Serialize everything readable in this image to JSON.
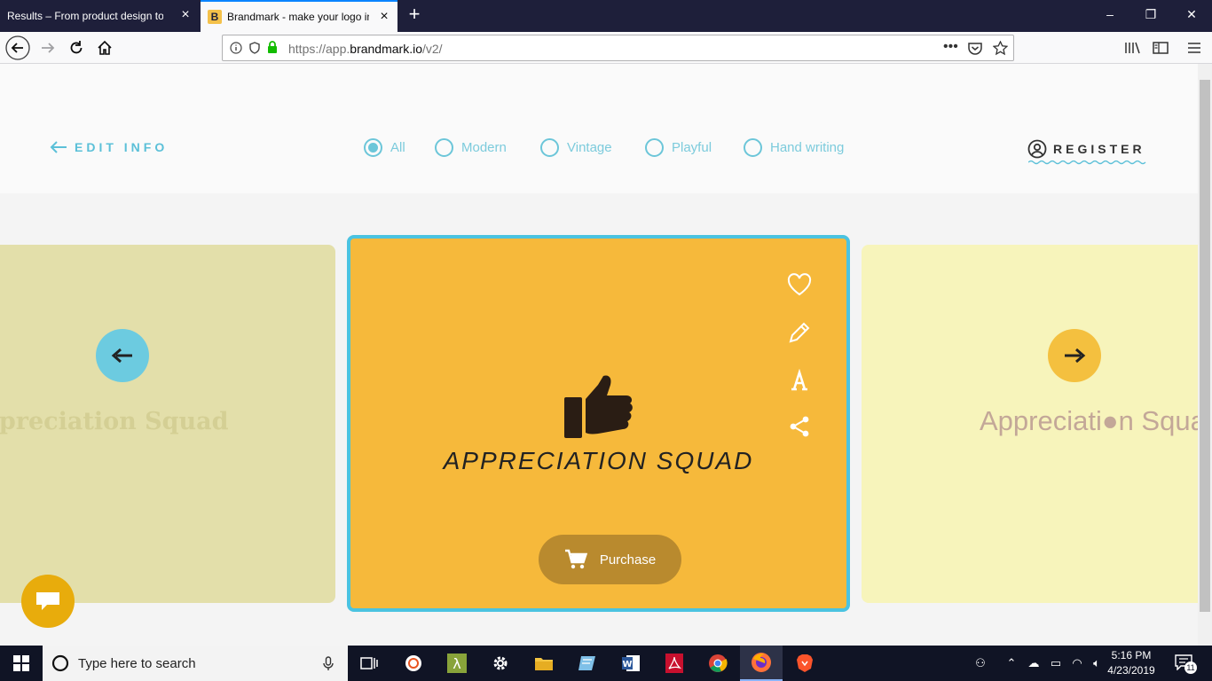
{
  "browser": {
    "tabs": [
      {
        "title": "Results – From product design to d"
      },
      {
        "title": "Brandmark - make your logo in",
        "favicon": "B"
      }
    ],
    "url": {
      "prefix": "https://app.",
      "domain": "brandmark.io",
      "path": "/v2/"
    }
  },
  "header": {
    "edit_info": "EDIT INFO",
    "styles": [
      "All",
      "Modern",
      "Vintage",
      "Playful",
      "Hand writing"
    ],
    "selected_style": "All",
    "register": "REGISTER"
  },
  "cards": {
    "left_name": "ppreciation Squad",
    "center_name": "APPRECIATION SQUAD",
    "right_name": "Appreciati●n Squa",
    "purchase": "Purchase"
  },
  "colors": {
    "accent": "#5bc0d8",
    "center_bg": "#f6b93b",
    "center_border": "#4bc3e0",
    "left_bg": "#e3dfaa",
    "right_bg": "#f7f4bb"
  },
  "taskbar": {
    "search_placeholder": "Type here to search",
    "time": "5:16 PM",
    "date": "4/23/2019",
    "notifications": "11"
  }
}
